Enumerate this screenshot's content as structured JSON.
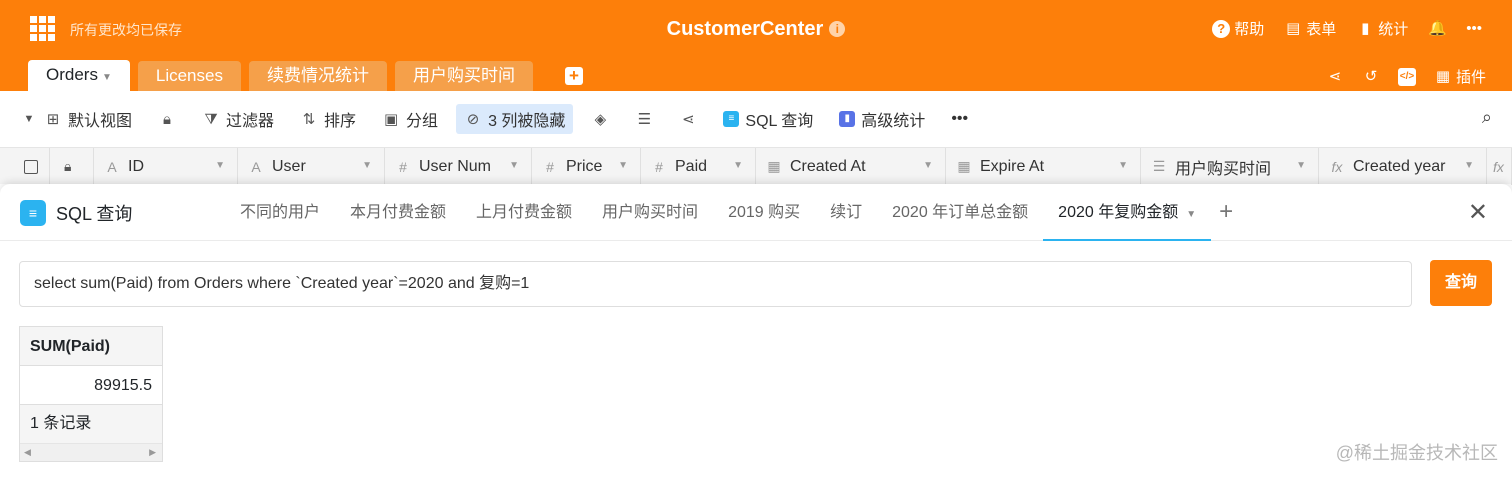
{
  "header": {
    "save_status": "所有更改均已保存",
    "base_title": "CustomerCenter",
    "help": "帮助",
    "form": "表单",
    "stats": "统计",
    "more": "•••"
  },
  "tables": {
    "tabs": [
      "Orders",
      "Licenses",
      "续费情况统计",
      "用户购买时间"
    ],
    "plugins": "插件"
  },
  "toolbar": {
    "view": "默认视图",
    "filter": "过滤器",
    "sort": "排序",
    "group": "分组",
    "hidden": "3 列被隐藏",
    "sql": "SQL 查询",
    "advanced": "高级统计",
    "more": "•••"
  },
  "columns": [
    {
      "type": "A",
      "name": "ID"
    },
    {
      "type": "A",
      "name": "User"
    },
    {
      "type": "#",
      "name": "User Num"
    },
    {
      "type": "#",
      "name": "Price"
    },
    {
      "type": "#",
      "name": "Paid"
    },
    {
      "type": "cal",
      "name": "Created At"
    },
    {
      "type": "cal",
      "name": "Expire At"
    },
    {
      "type": "list",
      "name": "用户购买时间"
    },
    {
      "type": "fx",
      "name": "Created year"
    }
  ],
  "sql_panel": {
    "title": "SQL 查询",
    "tabs": [
      "不同的用户",
      "本月付费金额",
      "上月付费金额",
      "用户购买时间",
      "2019 购买",
      "续订",
      "2020 年订单总金额",
      "2020 年复购金额"
    ],
    "active_tab": "2020 年复购金额",
    "query": "select sum(Paid) from Orders where  `Created year`=2020 and 复购=1",
    "run_label": "查询",
    "result": {
      "column": "SUM(Paid)",
      "value": "89915.5",
      "count": "1 条记录"
    }
  },
  "watermark": "@稀土掘金技术社区",
  "colors": {
    "brand": "#fd7f0a",
    "accent": "#2bb3f0"
  }
}
